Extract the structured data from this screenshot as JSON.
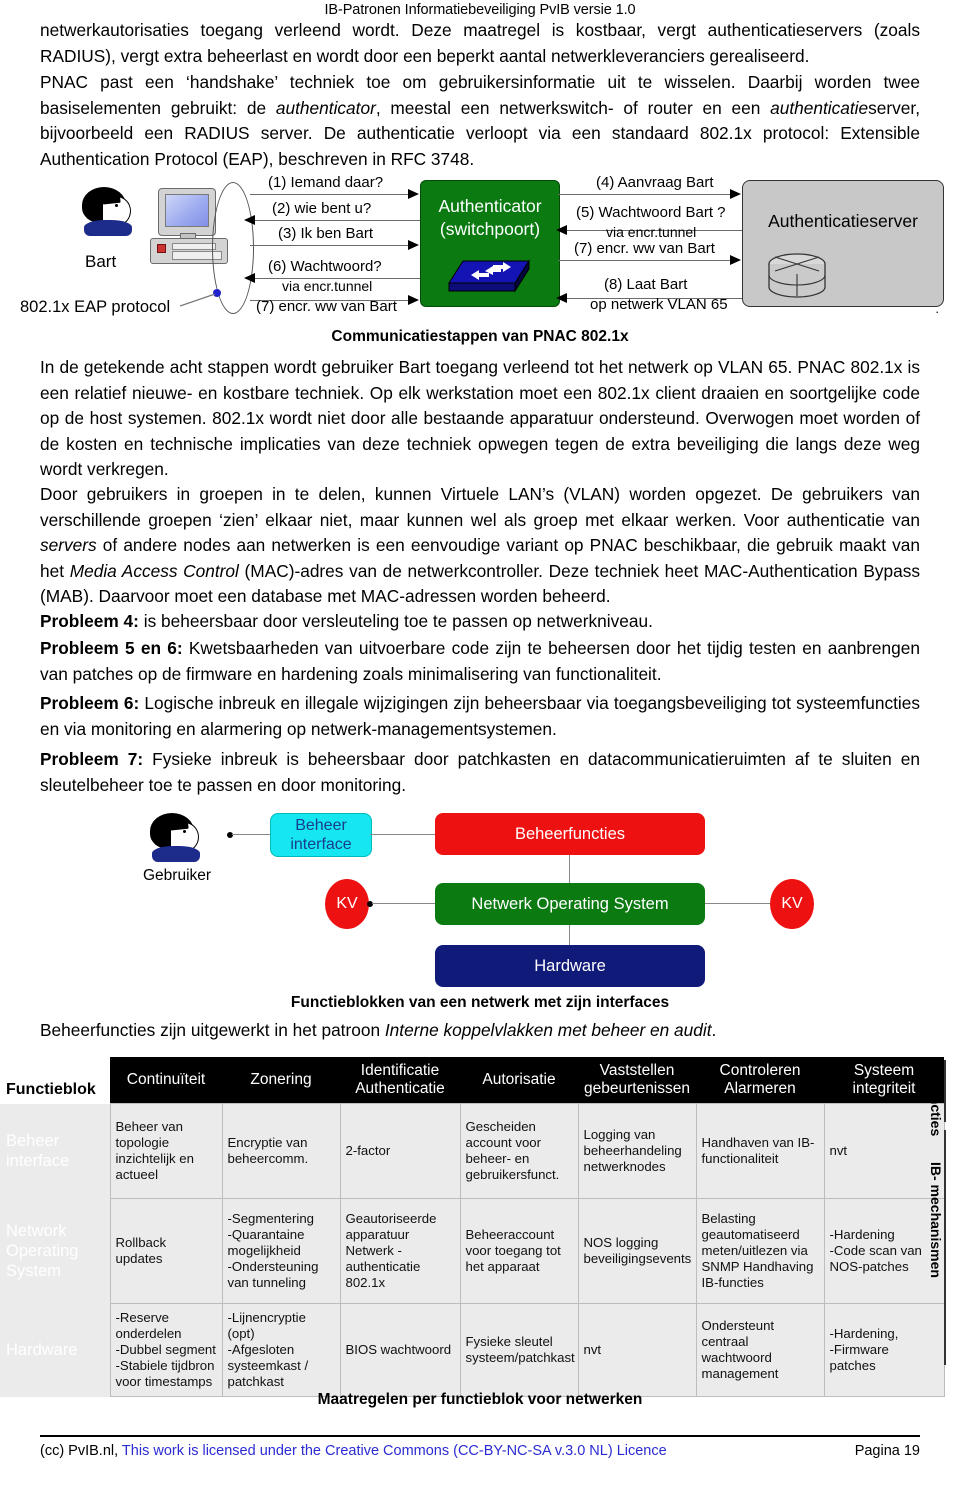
{
  "header": {
    "title": "IB-Patronen Informatiebeveiliging PvIB versie 1.0"
  },
  "paragraphs": {
    "p1_line1": "netwerkautorisaties toegang verleend wordt. ",
    "p1_line1b": "Deze maatregel is kostbaar, vergt authenticatieservers (zoals",
    "p1_rest": "RADIUS), vergt extra beheerlast en wordt door een beperkt aantal netwerkleveranciers gerealiseerd.",
    "p2_a": "PNAC past een ‘handshake’ techniek toe om gebruikersinformatie uit te wisselen. Daarbij worden twee basiselementen gebruikt: de ",
    "p2_i1": "authenticator",
    "p2_b": ", meestal een netwerkswitch- of router en een ",
    "p2_i2": "authenticatie",
    "p2_i2b": "server",
    "p2_c": ", bijvoorbeeld een RADIUS server. De authenticatie verloopt via een standaard 802.1x protocol: Extensible Authentication Protocol (EAP), beschreven in RFC 3748.",
    "p3": "In de getekende acht stappen wordt gebruiker Bart toegang verleend tot het netwerk op VLAN 65. PNAC 802.1x is een relatief nieuwe- en kostbare techniek. Op elk werkstation moet een 802.1x client draaien en soortgelijke code op de host systemen. 802.1x wordt niet door alle bestaande apparatuur ondersteund. Overwogen moet worden of de kosten en technische implicaties van deze techniek opwegen tegen de extra beveiliging die langs deze weg wordt verkregen.",
    "p4_a": "Door gebruikers in groepen in te delen, kunnen Virtuele LAN’s (VLAN) worden opgezet. De gebruikers van verschillende groepen ‘zien’ elkaar niet, maar kunnen wel als groep met elkaar werken. Voor authenticatie van ",
    "p4_i1": "servers",
    "p4_b": " of andere nodes aan netwerken is een eenvoudige variant op PNAC beschikbaar, die gebruik maakt van het ",
    "p4_i2": "Media Access Control",
    "p4_c": " (MAC)-adres van de netwerkcontroller. Deze techniek heet MAC-Authentication Bypass (MAB). Daarvoor moet een database met MAC-adressen worden beheerd.",
    "pr4_label": "Probleem 4:",
    "pr4_text": " is beheersbaar door versleuteling toe te passen op netwerkniveau.",
    "pr56_label": "Probleem 5 en 6:",
    "pr56_text": " Kwetsbaarheden van uitvoerbare code zijn te beheersen door het tijdig testen en aanbrengen van patches op de firmware en hardening zoals minimalisering van functionaliteit.",
    "pr6_label": "Probleem 6:",
    "pr6_text": " Logische inbreuk en illegale wijzigingen zijn beheersbaar via toegangsbeveiliging tot systeemfuncties en via monitoring en alarmering op netwerk-managementsystemen.",
    "pr7_label": "Probleem 7:",
    "pr7_text": " Fysieke inbreuk is beheersbaar door patchkasten en datacommunicatieruimten af te sluiten en sleutelbeheer toe te passen en door monitoring.",
    "p5_a": "Beheerfuncties zijn uitgewerkt in het patroon ",
    "p5_i": "Interne koppelvlakken met beheer en audit",
    "p5_b": "."
  },
  "diagram_pnac": {
    "user_label": "Bart",
    "protocol_label": "802.1x EAP protocol",
    "authenticator_line1": "Authenticator",
    "authenticator_line2": "(switchpoort)",
    "server_label": "Authenticatieserver",
    "server_dot": ".",
    "messages_left": [
      "(1) Iemand daar?",
      "(2) wie bent u?",
      "(3) Ik ben Bart",
      "(6) Wachtwoord?",
      "via encr.tunnel",
      "(7) encr. ww van Bart"
    ],
    "messages_right": [
      "(4) Aanvraag Bart",
      "(5) Wachtwoord Bart ?",
      "via encr.tunnel",
      "(7) encr. ww van  Bart",
      "(8) Laat Bart",
      "op netwerk VLAN 65"
    ],
    "caption": "Communicatiestappen van PNAC 802.1x"
  },
  "diagram_functieblokken": {
    "user_label": "Gebruiker",
    "beheer_interface": "Beheer\ninterface",
    "beheer_interface_l1": "Beheer",
    "beheer_interface_l2": "interface",
    "beheerfuncties": "Beheerfuncties",
    "nos": "Netwerk Operating System",
    "hardware": "Hardware",
    "kv_left": "KV",
    "kv_right": "KV",
    "caption": "Functieblokken van een netwerk met zijn interfaces"
  },
  "table": {
    "corner": "Functieblok",
    "columns": [
      "Continuïteit",
      "Zonering",
      "Identificatie\nAuthenticatie",
      "Autorisatie",
      "Vaststellen\ngebeurtenissen",
      "Controleren\nAlarmeren",
      "Systeem\nintegriteit"
    ],
    "columns_flat": [
      {
        "l1": "Continuïteit",
        "l2": ""
      },
      {
        "l1": "Zonering",
        "l2": ""
      },
      {
        "l1": "Identificatie",
        "l2": "Authenticatie"
      },
      {
        "l1": "Autorisatie",
        "l2": ""
      },
      {
        "l1": "Vaststellen",
        "l2": "gebeurtenissen"
      },
      {
        "l1": "Controleren",
        "l2": "Alarmeren"
      },
      {
        "l1": "Systeem",
        "l2": "integriteit"
      }
    ],
    "rows": [
      {
        "head": "Beheer\ninterface",
        "head_l1": "Beheer",
        "head_l2": "interface",
        "cells": [
          "Beheer van topologie inzichtelijk en actueel",
          "Encryptie van beheercomm.",
          "2-factor",
          "Gescheiden account  voor beheer- en gebruikersfunct.",
          "Logging van beheerhandeling netwerknodes",
          "Handhaven  van IB-functionaliteit",
          "nvt"
        ]
      },
      {
        "head": "Network\nOperating\nSystem",
        "head_l1": "Network",
        "head_l2": "Operating",
        "head_l3": "System",
        "cells": [
          "Rollback updates",
          "-Segmentering\n-Quarantaine mogelijkheid\n-Ondersteuning van tunneling",
          "Geautoriseerde apparatuur Netwerk - authenticatie 802.1x",
          "Beheeraccount voor toegang tot het apparaat",
          "NOS logging beveiligingsevents",
          "Belasting geautomatiseerd meten/uitlezen via SNMP Handhaving IB-functies",
          "-Hardening\n-Code scan van NOS-patches"
        ]
      },
      {
        "head": "Hardware",
        "head_l1": "Hardware",
        "cells": [
          "-Reserve onderdelen\n-Dubbel segment\n-Stabiele tijdbron voor timestamps",
          "-Lijnencryptie (opt)\n-Afgesloten systeemkast / patchkast",
          "BIOS wachtwoord",
          "Fysieke sleutel systeem/patchkast",
          "nvt",
          "Ondersteunt centraal wachtwoord management",
          "-Hardening,\n-Firmware patches"
        ]
      }
    ],
    "side_labels": [
      "IB- functies",
      "IB- mechanismen"
    ],
    "caption": "Maatregelen per functieblok voor netwerken"
  },
  "footer": {
    "cc": "(cc) PvIB.nl, ",
    "license": "This work is licensed under the Creative Commons (CC-BY-NC-SA  v.3.0 NL) Licence",
    "page": "Pagina 19"
  }
}
